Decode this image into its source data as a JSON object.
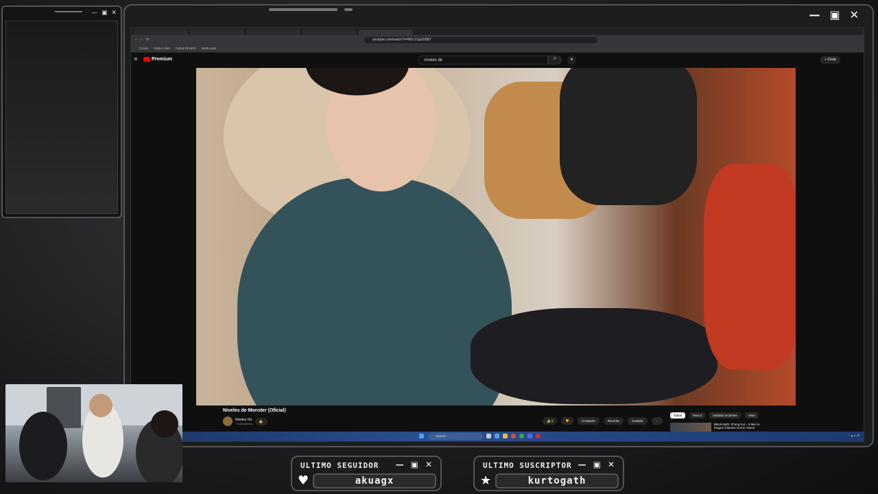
{
  "left_window": {
    "controls": [
      "—",
      "▣",
      "✕"
    ]
  },
  "frame": {
    "controls": [
      "—",
      "▣",
      "✕"
    ]
  },
  "browser": {
    "url": "youtube.com/watch?v=MD-17guDZ8iY",
    "bookmarks": [
      "Cortes",
      "Fútbol Libre",
      "Futbol PENDO",
      "Ninfa Kazir"
    ]
  },
  "youtube": {
    "logo": "Premium",
    "search_value": "niveles de",
    "search_icon": "search-icon",
    "create_label": "+ Crear",
    "video_title": "Niveles de Monster (Oficial)",
    "channel_name": "Niveles De",
    "channel_subs": "7 suscriptores",
    "actions": [
      "👍 0",
      "👎",
      "Compartir",
      "Recortar",
      "Guardar",
      "···"
    ],
    "chips": [
      "Todos",
      "Para ti",
      "Subidos recientes",
      "Visto"
    ],
    "recommended_title": "Black Myth: Zhong Kui – 6 Min In-Engine Chinese Horror Game"
  },
  "taskbar": {
    "search_placeholder": "Buscar"
  },
  "alerts": {
    "follower": {
      "title": "ULTIMO SEGUIDOR",
      "value": "akuagx",
      "icon": "heart-icon"
    },
    "subscriber": {
      "title": "ULTIMO SUSCRIPTOR",
      "value": "kurtogath",
      "icon": "star-icon"
    }
  }
}
